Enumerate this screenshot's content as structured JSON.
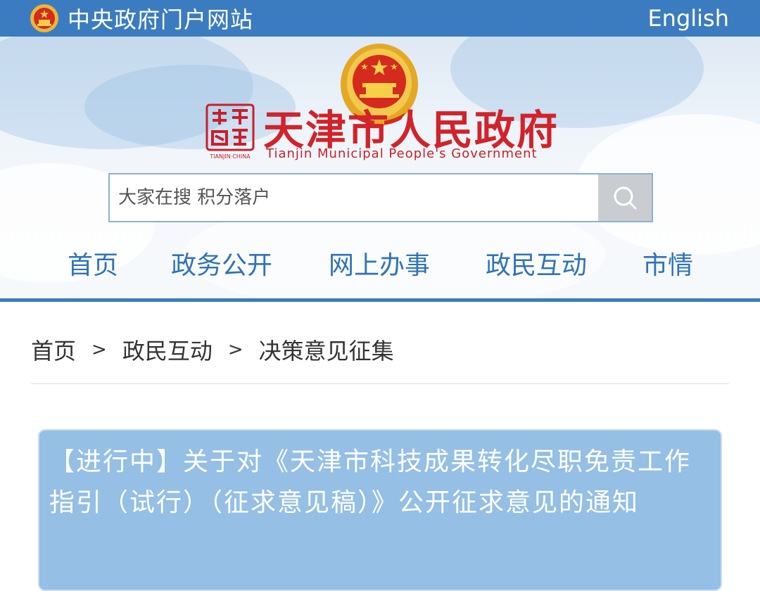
{
  "topbar": {
    "title": "中央政府门户网站",
    "english": "English",
    "emblem_icon": "national-emblem-icon"
  },
  "header": {
    "site_title": "天津市人民政府",
    "site_subtitle": "Tianjin Municipal People's Government",
    "seal_text": "TIANJIN·CHINA",
    "seal_icon": "tianjin-government-seal-icon",
    "emblem_icon": "national-emblem-icon"
  },
  "search": {
    "placeholder": "大家在搜 积分落户",
    "icon": "search-icon"
  },
  "nav": {
    "items": [
      {
        "label": "首页"
      },
      {
        "label": "政务公开"
      },
      {
        "label": "网上办事"
      },
      {
        "label": "政民互动"
      },
      {
        "label": "市情"
      }
    ]
  },
  "breadcrumb": {
    "items": [
      "首页",
      "政民互动",
      "决策意见征集"
    ],
    "separator": ">"
  },
  "notice": {
    "title": "【进行中】关于对《天津市科技成果转化尽职免责工作指引（试行）（征求意见稿）》公开征求意见的通知"
  },
  "colors": {
    "topbar": "#3b7cc0",
    "title_red": "#d2232a",
    "nav_blue": "#2f73b8",
    "card_bg": "#95bfe4"
  }
}
